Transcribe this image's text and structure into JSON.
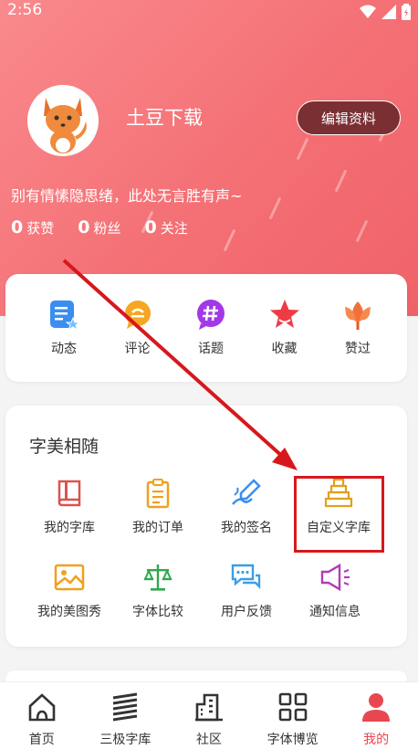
{
  "status_bar": {
    "time": "2:56",
    "icons": [
      "wifi-icon",
      "signal-icon",
      "battery-icon"
    ]
  },
  "profile": {
    "username": "土豆下载",
    "edit_label": "编辑资料",
    "bio": "别有情愫隐思绪，此处无言胜有声~",
    "stats": [
      {
        "num": "0",
        "label": "获赞"
      },
      {
        "num": "0",
        "label": "粉丝"
      },
      {
        "num": "0",
        "label": "关注"
      }
    ]
  },
  "quick_actions": [
    {
      "label": "动态",
      "icon": "post-icon",
      "color": "#3a8ef0"
    },
    {
      "label": "评论",
      "icon": "comment-icon",
      "color": "#f5a623"
    },
    {
      "label": "话题",
      "icon": "hashtag-icon",
      "color": "#a238e8"
    },
    {
      "label": "收藏",
      "icon": "star-icon",
      "color": "#ee3b44"
    },
    {
      "label": "赞过",
      "icon": "flower-icon",
      "color": "#f26f3a"
    }
  ],
  "section": {
    "title": "字美相随",
    "items": [
      {
        "label": "我的字库",
        "icon": "book-icon"
      },
      {
        "label": "我的订单",
        "icon": "clipboard-icon"
      },
      {
        "label": "我的签名",
        "icon": "signature-icon"
      },
      {
        "label": "自定义字库",
        "icon": "stack-icon"
      },
      {
        "label": "我的美图秀",
        "icon": "image-icon"
      },
      {
        "label": "字体比较",
        "icon": "scale-icon"
      },
      {
        "label": "用户反馈",
        "icon": "chat-icon"
      },
      {
        "label": "通知信息",
        "icon": "megaphone-icon"
      }
    ]
  },
  "tabs": [
    {
      "label": "首页",
      "icon": "home-icon"
    },
    {
      "label": "三极字库",
      "icon": "layers-icon"
    },
    {
      "label": "社区",
      "icon": "building-icon"
    },
    {
      "label": "字体博览",
      "icon": "grid-icon"
    },
    {
      "label": "我的",
      "icon": "person-icon",
      "active": true
    }
  ],
  "colors": {
    "header": "#f47075",
    "accent": "#e8474f",
    "highlight": "#d6181d"
  }
}
